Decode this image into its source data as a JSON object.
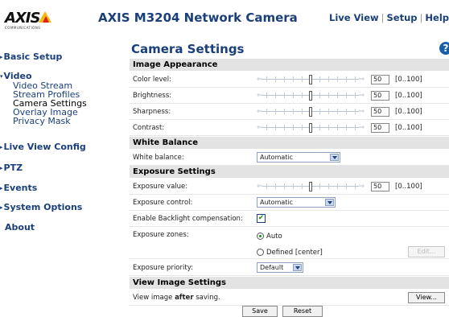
{
  "header": {
    "logo_text": "AXIS",
    "logo_subtext": "COMMUNICATIONS",
    "product_title": "AXIS M3204 Network Camera",
    "links": [
      "Live View",
      "Setup",
      "Help"
    ],
    "link_separator": "|"
  },
  "sidebar": {
    "items": [
      {
        "label": "Basic Setup",
        "expanded": false
      },
      {
        "label": "Video",
        "expanded": true,
        "children": [
          "Video Stream",
          "Stream Profiles",
          "Camera Settings",
          "Overlay Image",
          "Privacy Mask"
        ],
        "active_child": "Camera Settings"
      },
      {
        "label": "Live View Config",
        "expanded": false
      },
      {
        "label": "PTZ",
        "expanded": false
      },
      {
        "label": "Events",
        "expanded": false
      },
      {
        "label": "System Options",
        "expanded": false
      },
      {
        "label": "About",
        "expanded": false
      }
    ],
    "arrow_collapsed": "▸",
    "arrow_expanded": "▾"
  },
  "page": {
    "title": "Camera Settings",
    "help_icon": "?"
  },
  "image_appearance": {
    "heading": "Image Appearance",
    "rows": [
      {
        "label": "Color level:",
        "value": "50",
        "range": "[0..100]",
        "level": 0.5
      },
      {
        "label": "Brightness:",
        "value": "50",
        "range": "[0..100]",
        "level": 0.5
      },
      {
        "label": "Sharpness:",
        "value": "50",
        "range": "[0..100]",
        "level": 0.5
      },
      {
        "label": "Contrast:",
        "value": "50",
        "range": "[0..100]",
        "level": 0.5
      }
    ]
  },
  "white_balance": {
    "heading": "White Balance",
    "label": "White balance:",
    "selected": "Automatic"
  },
  "exposure": {
    "heading": "Exposure Settings",
    "value_label": "Exposure value:",
    "value": "50",
    "value_range": "[0..100]",
    "value_level": 0.5,
    "control_label": "Exposure control:",
    "control_selected": "Automatic",
    "backlight_label": "Enable Backlight compensation:",
    "backlight_checked": "✔",
    "zones_label": "Exposure zones:",
    "zone_auto": "Auto",
    "zone_defined": "Defined [center]",
    "zone_selected": "Auto",
    "edit_button": "Edit...",
    "priority_label": "Exposure priority:",
    "priority_selected": "Default"
  },
  "view_image": {
    "heading": "View Image Settings",
    "text_prefix": "View image ",
    "text_bold": "after",
    "text_suffix": " saving.",
    "view_button": "View..."
  },
  "actions": {
    "save": "Save",
    "reset": "Reset"
  },
  "colors": {
    "brand_blue": "#1a3f7a",
    "section_bg": "#e3e3e3",
    "logo_yellow": "#f2b90e",
    "logo_red": "#e0201a",
    "check_green": "#1a8a1a"
  }
}
